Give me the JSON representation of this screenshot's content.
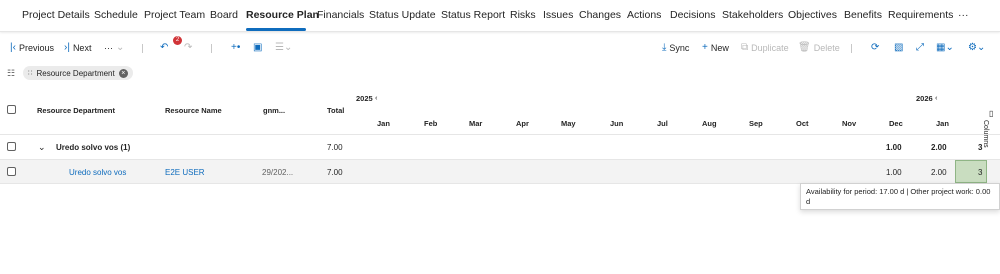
{
  "tabs": [
    {
      "label": "Project Details",
      "active": false
    },
    {
      "label": "Schedule",
      "active": false
    },
    {
      "label": "Project Team",
      "active": false
    },
    {
      "label": "Board",
      "active": false
    },
    {
      "label": "Resource Plan",
      "active": true
    },
    {
      "label": "Financials",
      "active": false
    },
    {
      "label": "Status Update",
      "active": false
    },
    {
      "label": "Status Report",
      "active": false
    },
    {
      "label": "Risks",
      "active": false
    },
    {
      "label": "Issues",
      "active": false
    },
    {
      "label": "Changes",
      "active": false
    },
    {
      "label": "Actions",
      "active": false
    },
    {
      "label": "Decisions",
      "active": false
    },
    {
      "label": "Stakeholders",
      "active": false
    },
    {
      "label": "Objectives",
      "active": false
    },
    {
      "label": "Benefits",
      "active": false
    },
    {
      "label": "Requirements",
      "active": false
    }
  ],
  "more_tabs": "···",
  "toolbar": {
    "previous": "Previous",
    "next": "Next",
    "more": "···",
    "undo_badge": "2",
    "sync": "Sync",
    "new": "New",
    "duplicate": "Duplicate",
    "delete": "Delete"
  },
  "filter": {
    "chip_label": "Resource Department"
  },
  "grid": {
    "headers": {
      "department": "Resource Department",
      "name": "Resource Name",
      "gnm": "gnm...",
      "total": "Total"
    },
    "year_2025": "2025",
    "year_2026": "2026",
    "months": [
      "Jan",
      "Feb",
      "Mar",
      "Apr",
      "May",
      "Jun",
      "Jul",
      "Aug",
      "Sep",
      "Oct",
      "Nov",
      "Dec",
      "Jan"
    ],
    "group_row": {
      "label": "Uredo solvo vos (1)",
      "total": "7.00",
      "dec": "1.00",
      "jan": "2.00",
      "next": "3"
    },
    "data_row": {
      "department": "Uredo solvo vos",
      "name": "E2E USER",
      "gnm": "29/202...",
      "total": "7.00",
      "dec": "1.00",
      "jan": "2.00",
      "next": "3"
    },
    "columns_label": "Columns"
  },
  "tooltip": {
    "text": "Availability for period: 17.00 d | Other project work: 0.00 d"
  },
  "colors": {
    "accent": "#0f6cbd",
    "badge": "#d13438",
    "highlight": "#c9ddc0"
  }
}
